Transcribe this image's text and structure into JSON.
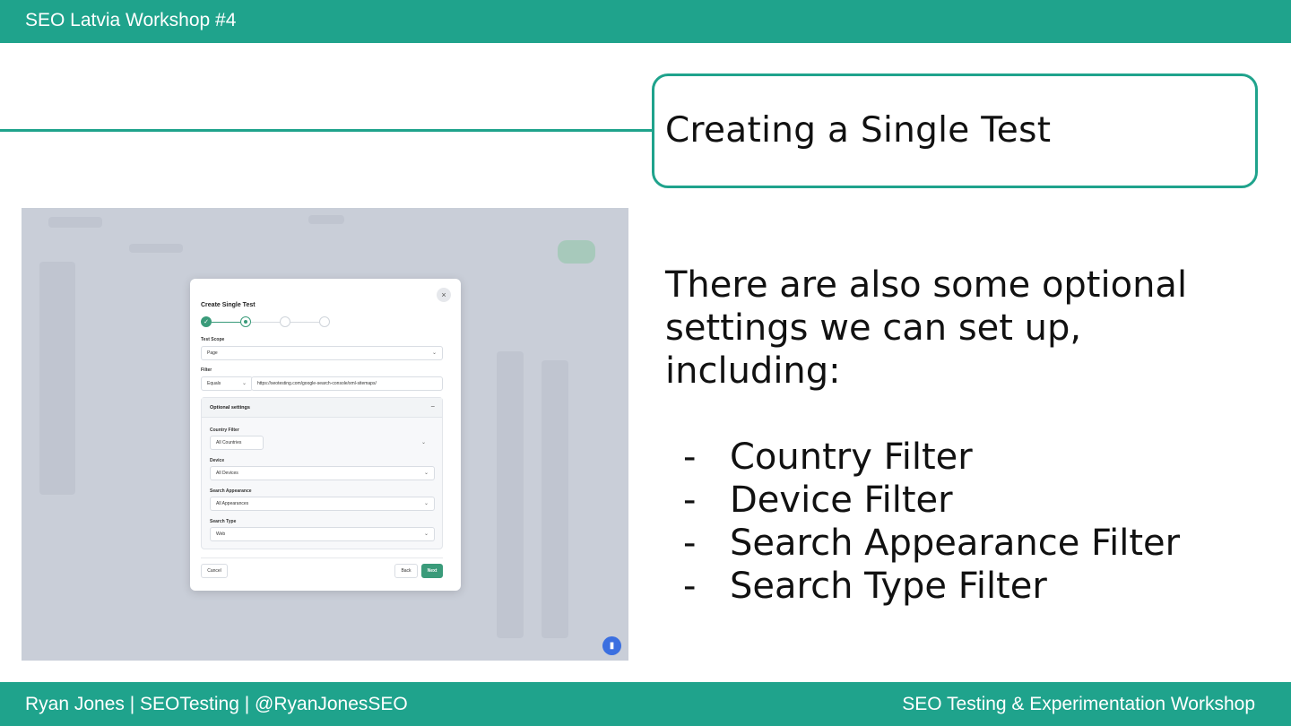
{
  "header": {
    "title": "SEO Latvia Workshop #4"
  },
  "slide": {
    "title": "Creating a Single Test",
    "body": "There are also some optional settings we can set up, including:",
    "bullets": [
      "Country Filter",
      "Device Filter",
      "Search Appearance Filter",
      "Search Type Filter"
    ],
    "bullet_marker": "-"
  },
  "footer": {
    "left": "Ryan Jones | SEOTesting | @RyanJonesSEO",
    "right": "SEO Testing & Experimentation Workshop"
  },
  "screenshot": {
    "modal": {
      "title": "Create Single Test",
      "close_icon": "×",
      "step_check": "✓",
      "test_scope_label": "Test Scope",
      "test_scope_value": "Page",
      "filter_label": "Filter",
      "filter_operator": "Equals",
      "filter_value": "https://seotesting.com/google-search-console/xml-sitemaps/",
      "optional_settings_title": "Optional settings",
      "collapse_icon": "−",
      "country_label": "Country Filter",
      "country_value": "All Countries",
      "device_label": "Device",
      "device_value": "All Devices",
      "appearance_label": "Search Appearance",
      "appearance_value": "All Appearances",
      "search_type_label": "Search Type",
      "search_type_value": "Web",
      "cancel_label": "Cancel",
      "back_label": "Back",
      "next_label": "Next"
    }
  },
  "colors": {
    "brand": "#1fa38c",
    "modal_primary": "#3a9b7a"
  }
}
